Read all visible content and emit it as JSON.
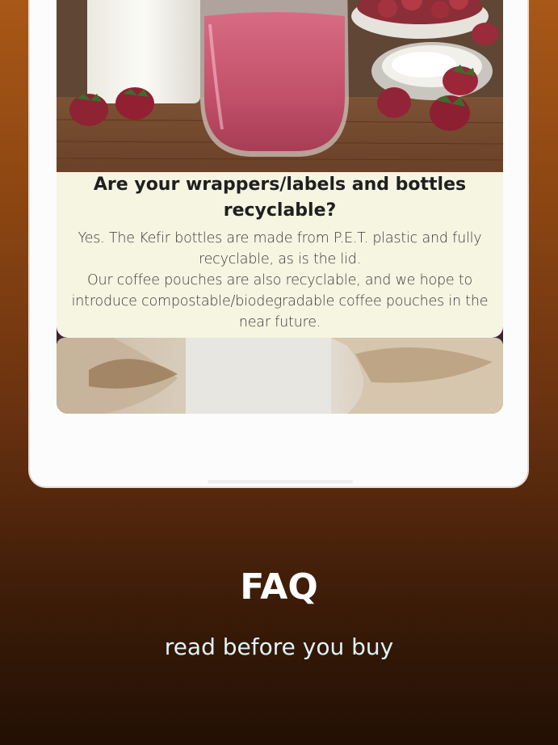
{
  "faq_item": {
    "question": "Are your wrappers/labels and bottles recyclable?",
    "answer_lines": [
      "Yes. The Kefir bottles are made from P.E.T. plastic and fully recyclable, as is the lid.",
      "Our coffee pouches are also recyclable, and we hope to introduce compostable/biodegradable coffee pouches in the near future."
    ]
  },
  "banner": {
    "title": "FAQ",
    "subtitle": "read before you buy"
  },
  "colors": {
    "answer_background": "#f6f5e2",
    "card_background": "#3d2238",
    "subtitle_color": "#dff5f7"
  }
}
